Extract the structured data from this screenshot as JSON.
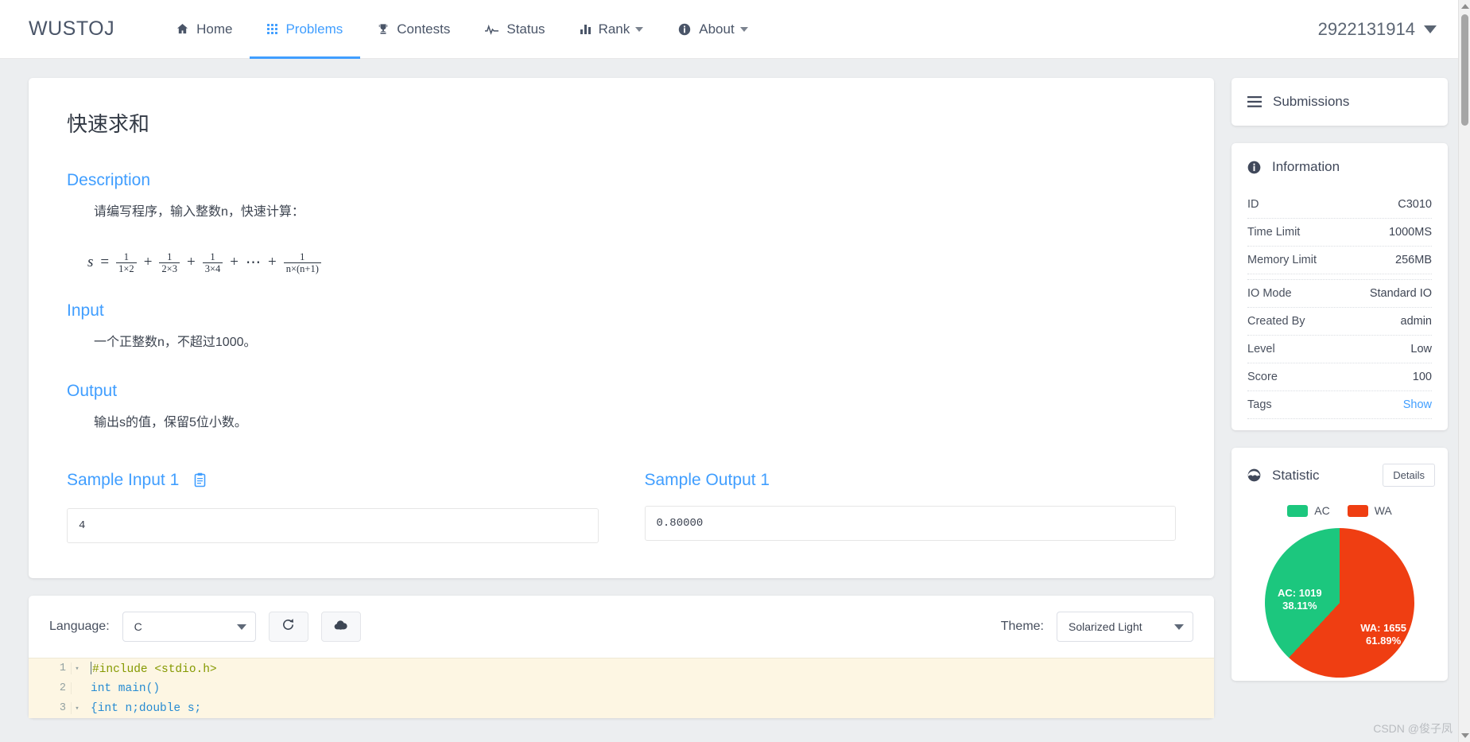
{
  "navbar": {
    "brand": "WUSTOJ",
    "items": [
      {
        "label": "Home",
        "icon": "home-icon",
        "active": false,
        "caret": false
      },
      {
        "label": "Problems",
        "icon": "grid-icon",
        "active": true,
        "caret": false
      },
      {
        "label": "Contests",
        "icon": "trophy-icon",
        "active": false,
        "caret": false
      },
      {
        "label": "Status",
        "icon": "pulse-icon",
        "active": false,
        "caret": false
      },
      {
        "label": "Rank",
        "icon": "bar-chart-icon",
        "active": false,
        "caret": true
      },
      {
        "label": "About",
        "icon": "info-circle-icon",
        "active": false,
        "caret": true
      }
    ],
    "user": "2922131914"
  },
  "problem": {
    "title": "快速求和",
    "description_heading": "Description",
    "description_text": "请编写程序，输入整数n，快速计算：",
    "formula": {
      "lhs": "s",
      "eq": "=",
      "terms": [
        {
          "num": "1",
          "den": "1×2"
        },
        {
          "num": "1",
          "den": "2×3"
        },
        {
          "num": "1",
          "den": "3×4"
        }
      ],
      "ellipsis": "⋯",
      "plus": "+",
      "last": {
        "num": "1",
        "den": "n×(n+1)"
      }
    },
    "input_heading": "Input",
    "input_text": "一个正整数n，不超过1000。",
    "output_heading": "Output",
    "output_text": "输出s的值，保留5位小数。",
    "sample_input_heading": "Sample Input 1",
    "sample_input": "4",
    "sample_output_heading": "Sample Output 1",
    "sample_output": "0.80000"
  },
  "sidebar": {
    "submissions_label": "Submissions",
    "information_label": "Information",
    "info_rows": [
      {
        "label": "ID",
        "value": "C3010",
        "link": false
      },
      {
        "label": "Time Limit",
        "value": "1000MS",
        "link": false
      },
      {
        "label": "Memory Limit",
        "value": "256MB",
        "link": false
      },
      {
        "label": "",
        "value": "",
        "link": false
      },
      {
        "label": "IO Mode",
        "value": "Standard IO",
        "link": false
      },
      {
        "label": "Created By",
        "value": "admin",
        "link": false
      },
      {
        "label": "Level",
        "value": "Low",
        "link": false
      },
      {
        "label": "Score",
        "value": "100",
        "link": false
      },
      {
        "label": "Tags",
        "value": "Show",
        "link": true
      }
    ],
    "statistic_label": "Statistic",
    "details_label": "Details"
  },
  "chart_data": {
    "type": "pie",
    "title": "Statistic",
    "categories": [
      "AC",
      "WA"
    ],
    "values": [
      1019,
      1655
    ],
    "percents": [
      38.11,
      61.89
    ],
    "labels": [
      "AC: 1019\n38.11%",
      "WA: 1655\n61.89%"
    ],
    "colors": [
      "#1cc77e",
      "#ef3e12"
    ],
    "legend": [
      "AC",
      "WA"
    ],
    "legend_position": "top"
  },
  "editor": {
    "language_label": "Language:",
    "language_value": "C",
    "reset_icon": "refresh-icon",
    "submit_icon": "cloud-upload-icon",
    "theme_label": "Theme:",
    "theme_value": "Solarized Light",
    "code_lines": [
      {
        "number": "1",
        "foldable": true,
        "text": "#include <stdio.h>"
      },
      {
        "number": "2",
        "foldable": false,
        "text": "int main()"
      },
      {
        "number": "3",
        "foldable": true,
        "text": "{int n;double s;"
      }
    ]
  },
  "watermark": "CSDN @俊子凤",
  "colors": {
    "accent": "#409eff",
    "ac_green": "#1cc77e",
    "wa_red": "#ef3e12",
    "text": "#4a5568"
  }
}
